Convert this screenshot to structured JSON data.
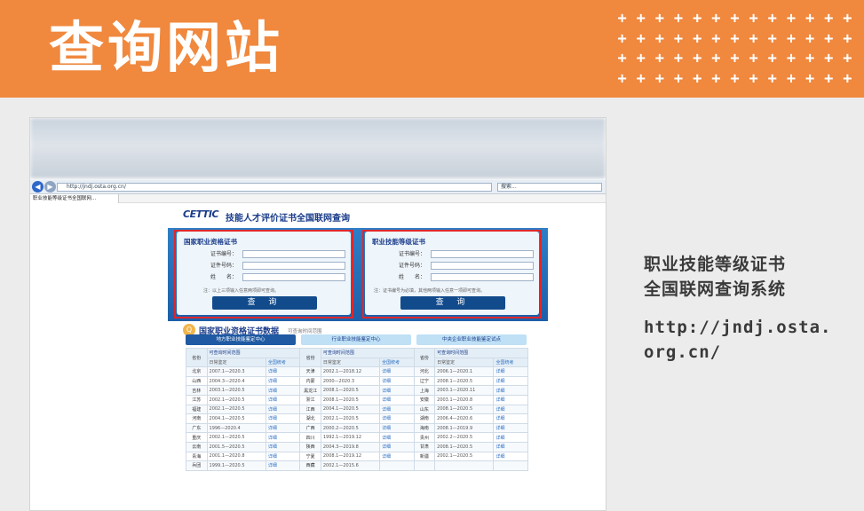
{
  "banner": {
    "title": "查询网站",
    "plus_glyph": "+"
  },
  "screenshot": {
    "address_bar": {
      "back_icon": "back-arrow-icon",
      "url": "http://jndj.osta.org.cn/",
      "search_placeholder": "搜索..."
    },
    "tab": {
      "label": "职业技能等级证书全国联网..."
    },
    "site_header": {
      "logo": "CETTIC",
      "title": "技能人才评价证书全国联网查询"
    },
    "panels": [
      {
        "title": "国家职业资格证书",
        "fields": [
          {
            "label": "证书编号："
          },
          {
            "label": "证件号码："
          },
          {
            "label": "姓　　名："
          }
        ],
        "note": "注：以上三项输入任意两项即可查询。",
        "button": "查 询"
      },
      {
        "title": "职业技能等级证书",
        "fields": [
          {
            "label": "证书编号："
          },
          {
            "label": "证件号码："
          },
          {
            "label": "姓　　名："
          }
        ],
        "note": "注：证书编号为必填，其他两项输入任意一项即可查询。",
        "button": "查 询"
      }
    ],
    "database": {
      "title": "国家职业资格证书数据",
      "subtitle": "可查询时间范围",
      "tabs": [
        "地方职业技能鉴定中心",
        "行业职业技能鉴定中心",
        "中央企业职业技能鉴定试点"
      ],
      "headers": {
        "province": "省份",
        "range": "可查询时间范围",
        "daily": "日常鉴定",
        "national": "全国统考"
      },
      "rows": [
        [
          {
            "p": "北京",
            "r": "2007.1—2020.3",
            "l": "详细"
          },
          {
            "p": "天津",
            "r": "2002.1—2018.12",
            "l": "详细"
          },
          {
            "p": "河北",
            "r": "2006.1—2020.1",
            "l": "详细"
          }
        ],
        [
          {
            "p": "山西",
            "r": "2004.3—2020.4",
            "l": "详细"
          },
          {
            "p": "内蒙",
            "r": "2000—2020.3",
            "l": "详细"
          },
          {
            "p": "辽宁",
            "r": "2008.1—2020.5",
            "l": "详细"
          }
        ],
        [
          {
            "p": "吉林",
            "r": "2003.1—2020.5",
            "l": "详细"
          },
          {
            "p": "黑龙江",
            "r": "2008.1—2020.5",
            "l": "详细"
          },
          {
            "p": "上海",
            "r": "2003.1—2020.11",
            "l": "详细"
          }
        ],
        [
          {
            "p": "江苏",
            "r": "2002.1—2020.5",
            "l": "详细"
          },
          {
            "p": "浙江",
            "r": "2008.1—2020.5",
            "l": "详细"
          },
          {
            "p": "安徽",
            "r": "2003.1—2020.8",
            "l": "详细"
          }
        ],
        [
          {
            "p": "福建",
            "r": "2002.1—2020.5",
            "l": "详细"
          },
          {
            "p": "江西",
            "r": "2004.1—2020.5",
            "l": "详细"
          },
          {
            "p": "山东",
            "r": "2008.1—2020.5",
            "l": "详细"
          }
        ],
        [
          {
            "p": "河南",
            "r": "2004.1—2020.5",
            "l": "详细"
          },
          {
            "p": "湖北",
            "r": "2002.1—2020.5",
            "l": "详细"
          },
          {
            "p": "湖南",
            "r": "2006.4—2020.6",
            "l": "详细"
          }
        ],
        [
          {
            "p": "广东",
            "r": "1996—2020.4",
            "l": "详细"
          },
          {
            "p": "广西",
            "r": "2000.2—2020.5",
            "l": "详细"
          },
          {
            "p": "海南",
            "r": "2008.1—2019.9",
            "l": "详细"
          }
        ],
        [
          {
            "p": "重庆",
            "r": "2002.1—2020.5",
            "l": "详细"
          },
          {
            "p": "四川",
            "r": "1992.1—2019.12",
            "l": "详细"
          },
          {
            "p": "贵州",
            "r": "2002.2—2020.5",
            "l": "详细"
          }
        ],
        [
          {
            "p": "云南",
            "r": "2001.5—2020.5",
            "l": "详细"
          },
          {
            "p": "陕西",
            "r": "2004.3—2019.8",
            "l": "详细"
          },
          {
            "p": "甘肃",
            "r": "2008.1—2020.5",
            "l": "详细"
          }
        ],
        [
          {
            "p": "青海",
            "r": "2001.1—2020.8",
            "l": "详细"
          },
          {
            "p": "宁夏",
            "r": "2008.1—2019.12",
            "l": "详细"
          },
          {
            "p": "新疆",
            "r": "2002.1—2020.5",
            "l": "详细"
          }
        ],
        [
          {
            "p": "兵团",
            "r": "1999.1—2020.5",
            "l": "详细"
          },
          {
            "p": "西藏",
            "r": "2002.1—2015.6",
            "l": ""
          },
          {
            "p": "",
            "r": "",
            "l": ""
          }
        ]
      ]
    }
  },
  "description": {
    "line1": "职业技能等级证书",
    "line2": "全国联网查询系统",
    "url_line1": "http://jndj.osta.",
    "url_line2": "org.cn/"
  },
  "colors": {
    "banner": "#f0883e",
    "highlight": "#e0262b",
    "site_blue": "#1a3c8a"
  }
}
